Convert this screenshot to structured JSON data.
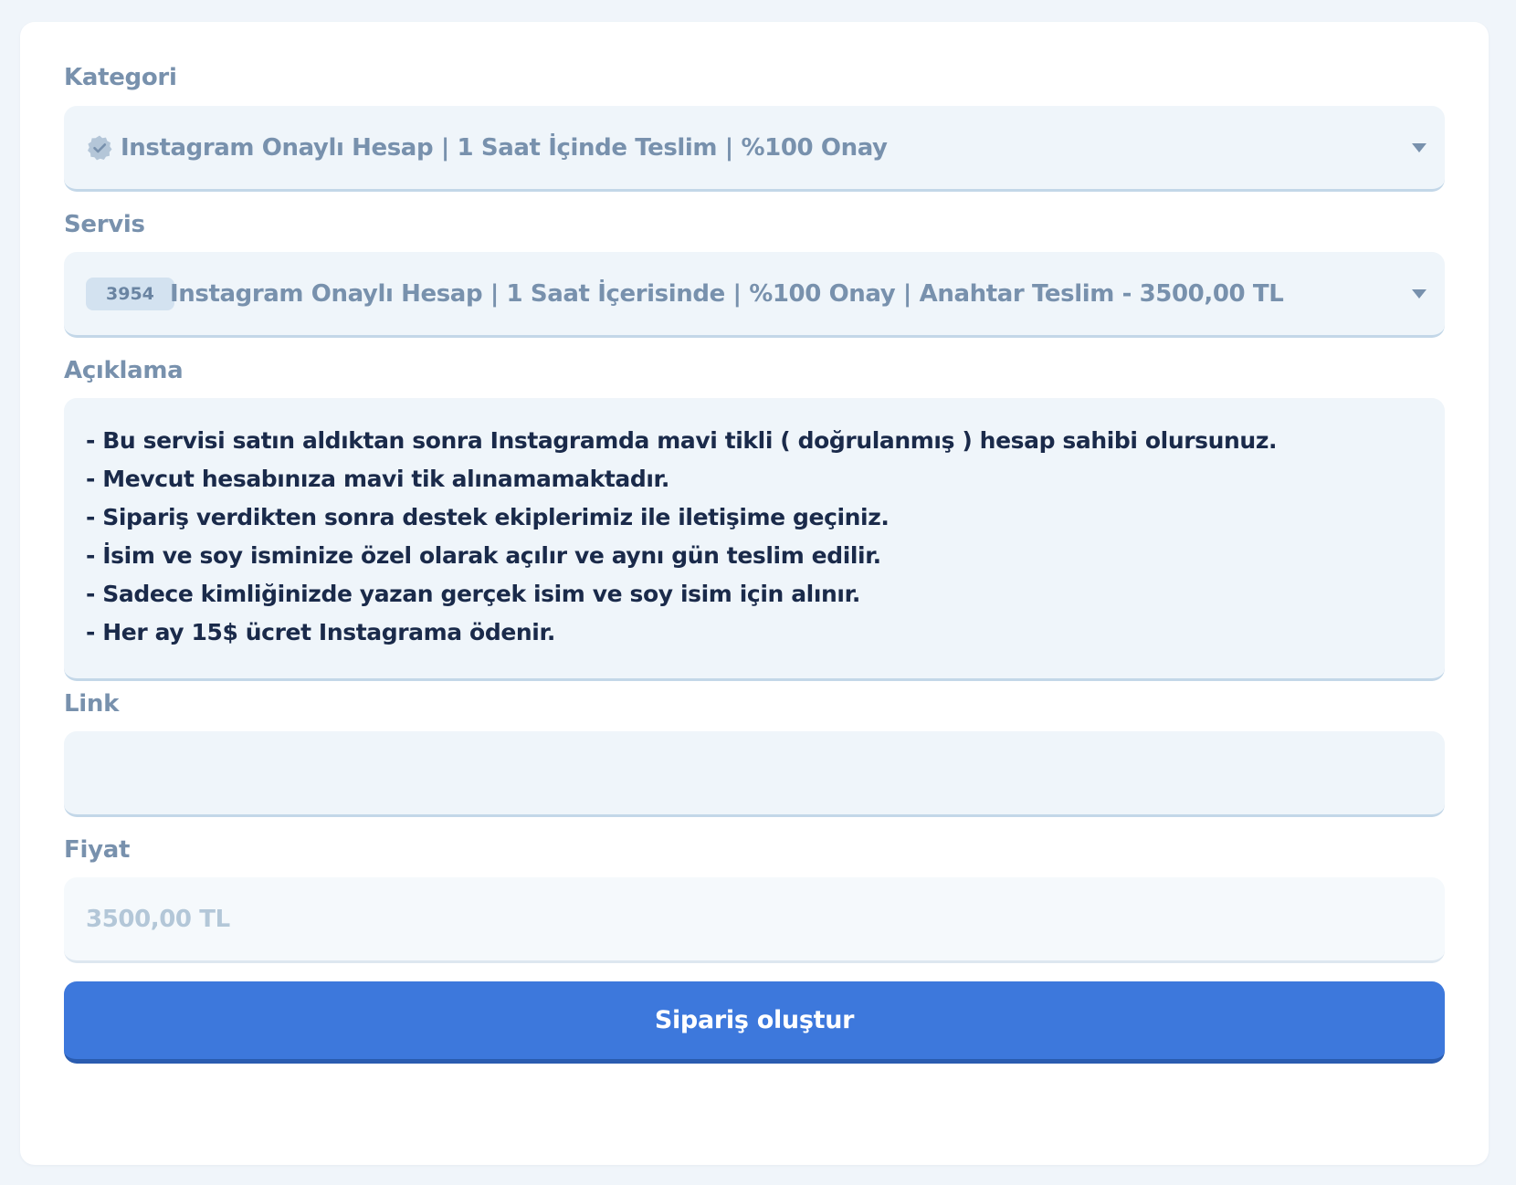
{
  "form": {
    "category": {
      "label": "Kategori",
      "icon": "verified-badge-icon",
      "selected": "Instagram Onaylı Hesap | 1 Saat İçinde Teslim | %100 Onay"
    },
    "service": {
      "label": "Servis",
      "badge": "3954",
      "selected": "Instagram Onaylı Hesap | 1 Saat İçerisinde | %100 Onay | Anahtar Teslim - 3500,00 TL"
    },
    "description": {
      "label": "Açıklama",
      "lines": [
        "- Bu servisi satın aldıktan sonra Instagramda mavi tikli ( doğrulanmış ) hesap sahibi olursunuz.",
        "- Mevcut hesabınıza mavi tik alınamamaktadır.",
        "- Sipariş verdikten sonra destek ekiplerimiz ile iletişime geçiniz.",
        "- İsim ve soy isminize özel olarak açılır ve aynı gün teslim edilir.",
        "- Sadece kimliğinizde yazan gerçek isim ve soy isim için alınır.",
        "- Her ay 15$ ücret Instagrama ödenir."
      ]
    },
    "link": {
      "label": "Link",
      "value": ""
    },
    "price": {
      "label": "Fiyat",
      "value": "3500,00 TL"
    },
    "submit_label": "Sipariş oluştur"
  },
  "colors": {
    "accent": "#3d78dc",
    "label": "#7891ad",
    "field_bg": "#eff5fa",
    "text_dark": "#1a2a4a"
  }
}
